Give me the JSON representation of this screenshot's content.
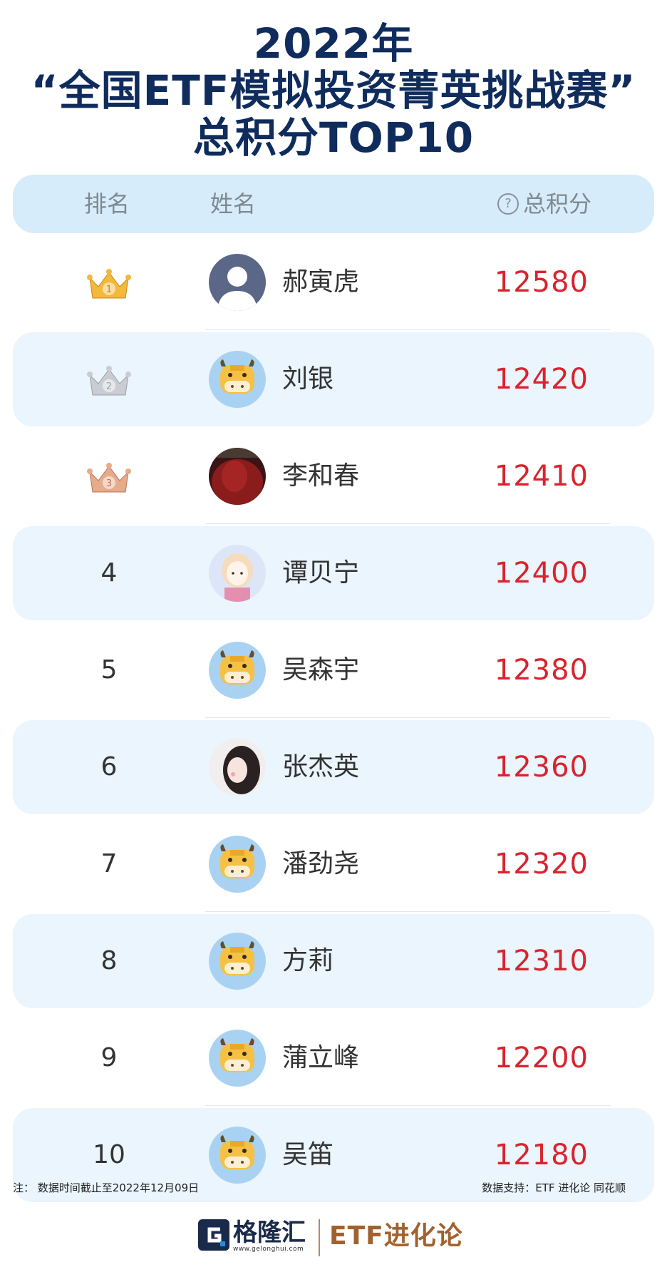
{
  "title": {
    "line1": "2022年",
    "line2": "“全国ETF模拟投资菁英挑战赛”",
    "line3": "总积分TOP10"
  },
  "header": {
    "rank_label": "排名",
    "name_label": "姓名",
    "help_icon": "question-circle-icon",
    "help_glyph": "?",
    "score_label": "总积分"
  },
  "rows": [
    {
      "rank": "1",
      "name": "郝寅虎",
      "score": "12580",
      "avatar": "default-silhouette"
    },
    {
      "rank": "2",
      "name": "刘银",
      "score": "12420",
      "avatar": "cow"
    },
    {
      "rank": "3",
      "name": "李和春",
      "score": "12410",
      "avatar": "photo-red"
    },
    {
      "rank": "4",
      "name": "谭贝宁",
      "score": "12400",
      "avatar": "cartoon-girl"
    },
    {
      "rank": "5",
      "name": "吴森宇",
      "score": "12380",
      "avatar": "cow"
    },
    {
      "rank": "6",
      "name": "张杰英",
      "score": "12360",
      "avatar": "photo-girl"
    },
    {
      "rank": "7",
      "name": "潘劲尧",
      "score": "12320",
      "avatar": "cow"
    },
    {
      "rank": "8",
      "name": "方莉",
      "score": "12310",
      "avatar": "cow"
    },
    {
      "rank": "9",
      "name": "蒲立峰",
      "score": "12200",
      "avatar": "cow"
    },
    {
      "rank": "10",
      "name": "吴笛",
      "score": "12180",
      "avatar": "cow"
    }
  ],
  "footnote": {
    "left": "注：  数据时间截止至2022年12月09日",
    "right": "数据支持：ETF 进化论    同花顺"
  },
  "logos": {
    "gelonghui": "格隆汇",
    "gelonghui_url": "www.gelonghui.com",
    "etf": "ETF进化论"
  },
  "colors": {
    "title": "#0f2c5c",
    "score": "#d9232e",
    "header_bg": "#d6ecfb",
    "alt_row_bg": "#eaf5fd",
    "gold": "#f2b93a",
    "silver": "#c9ccd2",
    "bronze": "#e6ab8a"
  }
}
